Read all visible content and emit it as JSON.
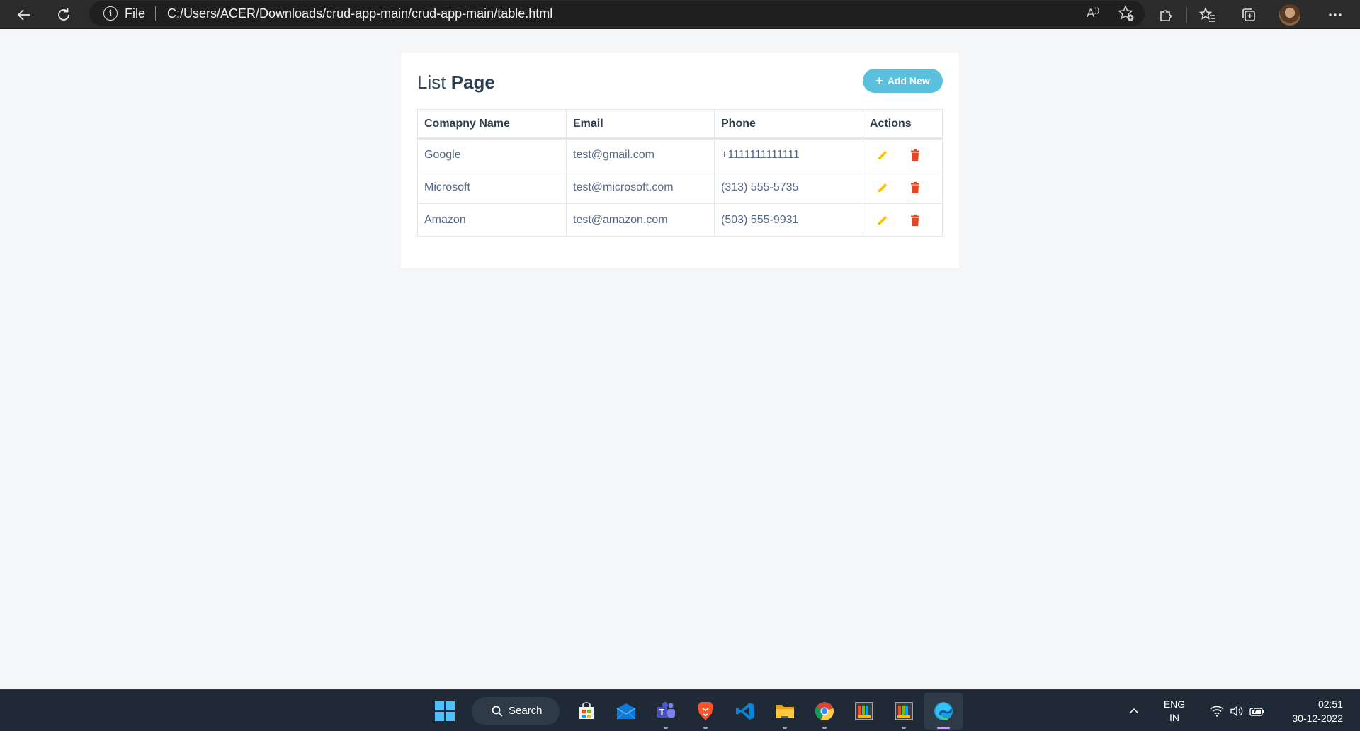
{
  "browser": {
    "file_label": "File",
    "url": "C:/Users/ACER/Downloads/crud-app-main/crud-app-main/table.html",
    "read_aloud_label": "A"
  },
  "page": {
    "title_light": "List",
    "title_bold": "Page",
    "add_button_label": "Add New"
  },
  "table": {
    "headers": [
      "Comapny Name",
      "Email",
      "Phone",
      "Actions"
    ],
    "rows": [
      {
        "company": "Google",
        "email": "test@gmail.com",
        "phone": "+1111111111111"
      },
      {
        "company": "Microsoft",
        "email": "test@microsoft.com",
        "phone": "(313) 555-5735"
      },
      {
        "company": "Amazon",
        "email": "test@amazon.com",
        "phone": "(503) 555-9931"
      }
    ],
    "edit_color": "#ffc107",
    "delete_color": "#e34724"
  },
  "taskbar": {
    "search_label": "Search",
    "lang_line1": "ENG",
    "lang_line2": "IN",
    "time": "02:51",
    "date": "30-12-2022"
  }
}
